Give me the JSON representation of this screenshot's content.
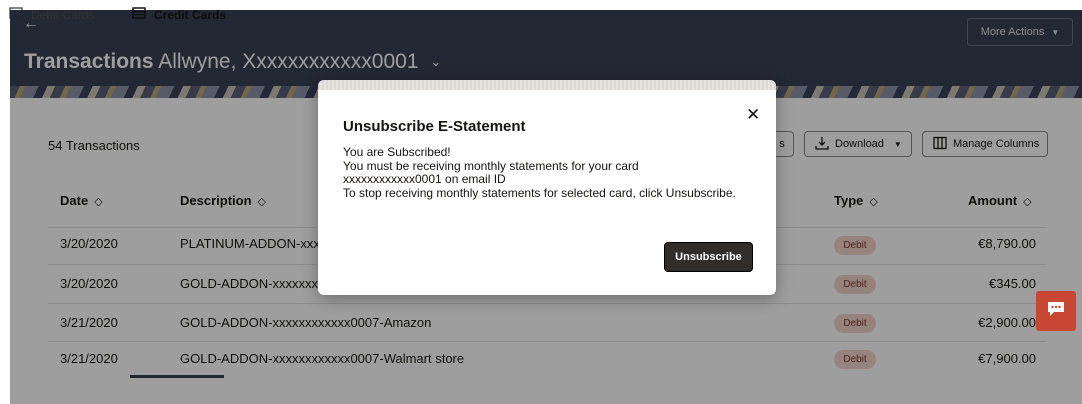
{
  "header": {
    "back_icon": "back-arrow-icon",
    "title_bold": "Transactions",
    "title_account": "Allwyne, Xxxxxxxxxxxx0001",
    "title_chevron": "⌄",
    "more_actions_label": "More Actions",
    "more_actions_arrow": "▼"
  },
  "toolbar": {
    "count_label": "54 Transactions",
    "partial_button_label": "s",
    "download_label": "Download",
    "download_arrow": "▼",
    "manage_columns_label": "Manage Columns"
  },
  "table": {
    "sort_glyph": "◇",
    "columns": {
      "date": "Date",
      "description": "Description",
      "type": "Type",
      "amount": "Amount"
    },
    "rows": [
      {
        "date": "3/20/2020",
        "description": "PLATINUM-ADDON-xxxx",
        "type": "Debit",
        "amount": "€8,790.00"
      },
      {
        "date": "3/20/2020",
        "description": "GOLD-ADDON-xxxxxxxx",
        "type": "Debit",
        "amount": "€345.00"
      },
      {
        "date": "3/21/2020",
        "description": "GOLD-ADDON-xxxxxxxxxxxx0007-Amazon",
        "type": "Debit",
        "amount": "€2,900.00"
      },
      {
        "date": "3/21/2020",
        "description": "GOLD-ADDON-xxxxxxxxxxxx0007-Walmart store",
        "type": "Debit",
        "amount": "€7,900.00"
      }
    ]
  },
  "tabs": [
    {
      "label": "Debit Cards",
      "icon": "card-icon",
      "selected": false
    },
    {
      "label": "Credit Cards",
      "icon": "card-icon",
      "selected": true
    }
  ],
  "chat": {
    "icon": "chat-icon"
  },
  "modal": {
    "title": "Unsubscribe E-Statement",
    "close_glyph": "✕",
    "lines": [
      "You are Subscribed!",
      "You must be receiving monthly statements for your card",
      "xxxxxxxxxxxx0001 on email ID",
      "To stop receiving monthly statements for selected card, click Unsubscribe."
    ],
    "unsubscribe_label": "Unsubscribe"
  },
  "colors": {
    "header_bg": "#3a3f55",
    "primary_button": "#312d2a",
    "debit_badge_bg": "#f2d3cb",
    "chat_button": "#c74634"
  }
}
